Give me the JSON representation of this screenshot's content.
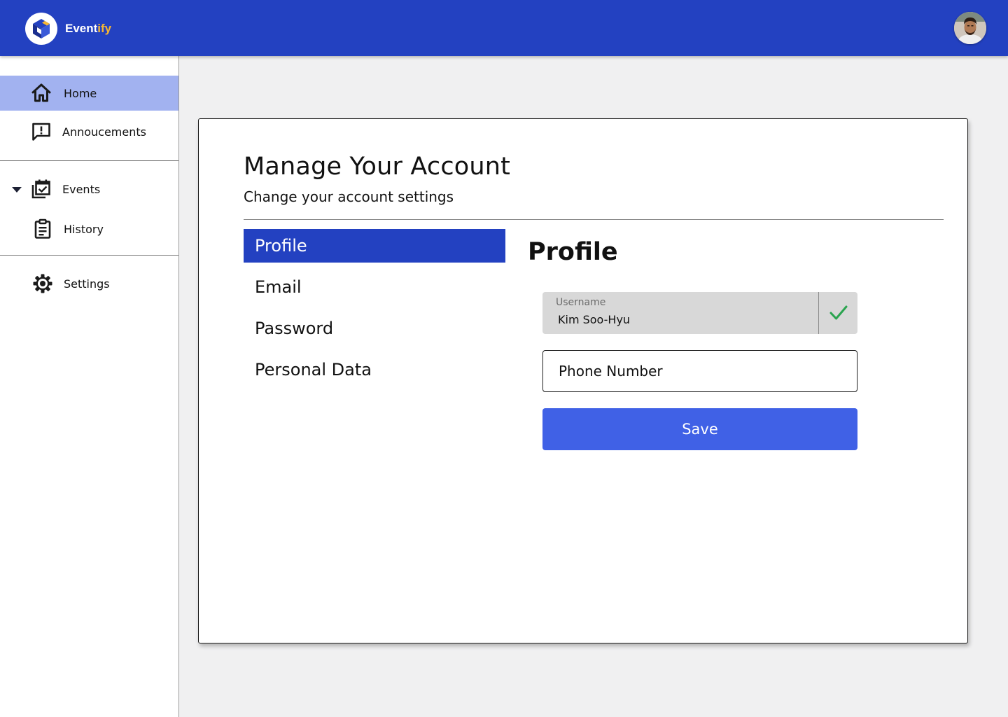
{
  "app": {
    "brand_main": "Event",
    "brand_accent": "ify",
    "logo_icon": "cube-logo-icon",
    "avatar_icon": "user-avatar"
  },
  "sidebar": {
    "items": [
      {
        "label": "Home",
        "icon": "home-icon",
        "active": true
      },
      {
        "label": "Annoucements",
        "icon": "announcement-icon"
      },
      {
        "label": "Events",
        "icon": "calendar-check-icon",
        "expanded": true
      },
      {
        "label": "History",
        "icon": "clipboard-icon"
      },
      {
        "label": "Settings",
        "icon": "gear-icon"
      }
    ]
  },
  "account": {
    "title": "Manage Your Account",
    "subtitle": "Change your account settings",
    "tabs": [
      {
        "label": "Profile",
        "active": true
      },
      {
        "label": "Email"
      },
      {
        "label": "Password"
      },
      {
        "label": "Personal Data"
      }
    ],
    "section_title": "Profile",
    "username_label": "Username",
    "username_value": "Kim Soo-Hyu",
    "phone_placeholder": "Phone Number",
    "save_label": "Save"
  },
  "colors": {
    "header": "#2341c1",
    "active_nav": "#a2b2f0",
    "active_tab": "#2341c1",
    "save_button": "#4061e6",
    "brand_accent": "#f7b733",
    "check": "#2aa44f"
  }
}
